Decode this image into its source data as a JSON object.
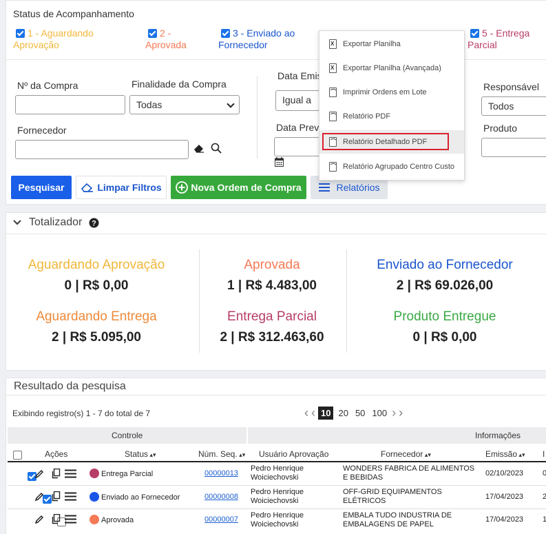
{
  "status": {
    "title": "Status de Acompanhamento",
    "items": [
      {
        "label_1": "1 - Aguardando",
        "label_2": "Aprovação",
        "color": "#f0b73a"
      },
      {
        "label_1": "2 -",
        "label_2": "Aprovada",
        "color": "#f47a55"
      },
      {
        "label_1": "3 - Enviado ao",
        "label_2": "Fornecedor",
        "color": "#1a55cc"
      },
      {
        "label_1": "5 - Entrega",
        "label_2": "Parcial",
        "color": "#b83c68"
      }
    ]
  },
  "filters": {
    "compra_label": "Nº da Compra",
    "finalidade_label": "Finalidade da Compra",
    "finalidade_value": "Todas",
    "data_emis_label": "Data Emis",
    "igual_value": "Igual a",
    "data_prev_label": "Data Prev.",
    "responsavel_label": "Responsável",
    "responsavel_value": "Todos",
    "fornecedor_label": "Fornecedor",
    "produto_label": "Produto"
  },
  "buttons": {
    "pesquisar": "Pesquisar",
    "limpar": "Limpar Filtros",
    "nova": "Nova Ordem de Compra",
    "relatorios": "Relatórios"
  },
  "menu": {
    "items": [
      {
        "label": "Exportar Planilha",
        "icon": "x"
      },
      {
        "label": "Exportar Planilha (Avançada)",
        "icon": "x"
      },
      {
        "label": "Imprimir Ordens em Lote",
        "icon": "pdf"
      },
      {
        "label": "Relatório PDF",
        "icon": "pdf"
      },
      {
        "label": "Relatório Detalhado PDF",
        "icon": "pdf"
      },
      {
        "label": "Relatório Agrupado Centro Custo",
        "icon": "pdf"
      }
    ]
  },
  "totalizador": {
    "title": "Totalizador",
    "cards": [
      {
        "title": "Aguardando Aprovação",
        "value": "0 | R$ 0,00",
        "color": "#f0b73a"
      },
      {
        "title": "Aprovada",
        "value": "1 | R$ 4.483,00",
        "color": "#f47a55"
      },
      {
        "title": "Enviado ao Fornecedor",
        "value": "2 | R$ 69.026,00",
        "color": "#1a55cc"
      },
      {
        "title": "Aguardando Entrega",
        "value": "2 | R$ 5.095,00",
        "color": "#ee8a3a"
      },
      {
        "title": "Entrega Parcial",
        "value": "2 | R$ 312.463,60",
        "color": "#b83c68"
      },
      {
        "title": "Produto Entregue",
        "value": "0 | R$ 0,00",
        "color": "#3aa845"
      }
    ]
  },
  "results": {
    "title": "Resultado da pesquisa",
    "showing": "Exibindo registro(s) 1 - 7 do total de 7",
    "page_sizes": [
      "10",
      "20",
      "50",
      "100"
    ],
    "group_controle": "Controle",
    "group_info": "Informações",
    "columns": {
      "acoes": "Ações",
      "status": "Status",
      "num_seq": "Núm. Seq.",
      "usuario": "Usuário Aprovação",
      "fornecedor": "Fornecedor",
      "emissao": "Emissão"
    },
    "rows": [
      {
        "checked": true,
        "status": "Entrega Parcial",
        "status_color": "#b83c68",
        "num": "00000013",
        "user_1": "Pedro Henrique",
        "user_2": "Woiciechovski",
        "forn_1": "WONDERS FABRICA DE ALIMENTOS",
        "forn_2": "E BEBIDAS",
        "emissao": "02/10/2023",
        "extra": "0"
      },
      {
        "checked": true,
        "status": "Enviado ao Fornecedor",
        "status_color": "#1a55e8",
        "num": "00000008",
        "user_1": "Pedro Henrique",
        "user_2": "Woiciechovski",
        "forn_1": "OFF-GRID EQUIPAMENTOS",
        "forn_2": "ELÉTRICOS",
        "emissao": "17/04/2023",
        "extra": "2"
      },
      {
        "checked": false,
        "status": "Aprovada",
        "status_color": "#f47a55",
        "num": "00000007",
        "user_1": "Pedro Henrique",
        "user_2": "Woiciechovski",
        "forn_1": "EMBALA TUDO INDUSTRIA DE",
        "forn_2": "EMBALAGENS DE PAPEL",
        "emissao": "17/04/2023",
        "extra": "1"
      }
    ]
  }
}
